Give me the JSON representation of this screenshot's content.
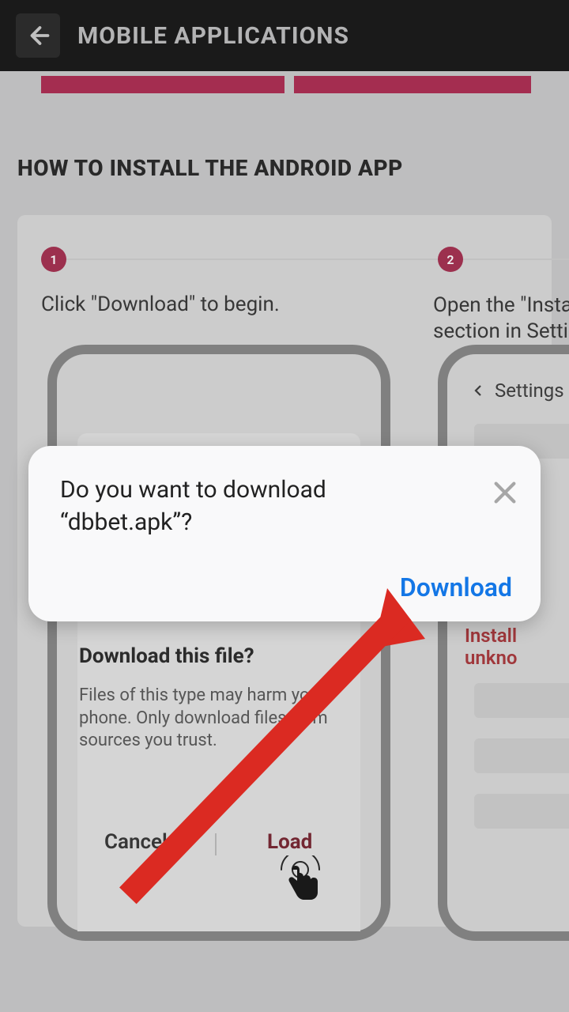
{
  "header": {
    "title": "MOBILE APPLICATIONS"
  },
  "section_heading": "HOW TO INSTALL THE ANDROID APP",
  "steps": {
    "s1": {
      "num": "1",
      "text": "Click \"Download\" to begin."
    },
    "s2": {
      "num": "2",
      "text_line1": "Open the \"Insta",
      "text_line2": "section in Setti",
      "settings_label": "Settings",
      "install_unknown": "Install unkno"
    }
  },
  "inner_dialog": {
    "title": "Download this file?",
    "body": "Files of this type may harm your phone. Only download files from sources you trust.",
    "cancel": "Cancel",
    "load": "Load"
  },
  "modal": {
    "message": "Do you want to download “dbbet.apk”?",
    "download": "Download"
  }
}
